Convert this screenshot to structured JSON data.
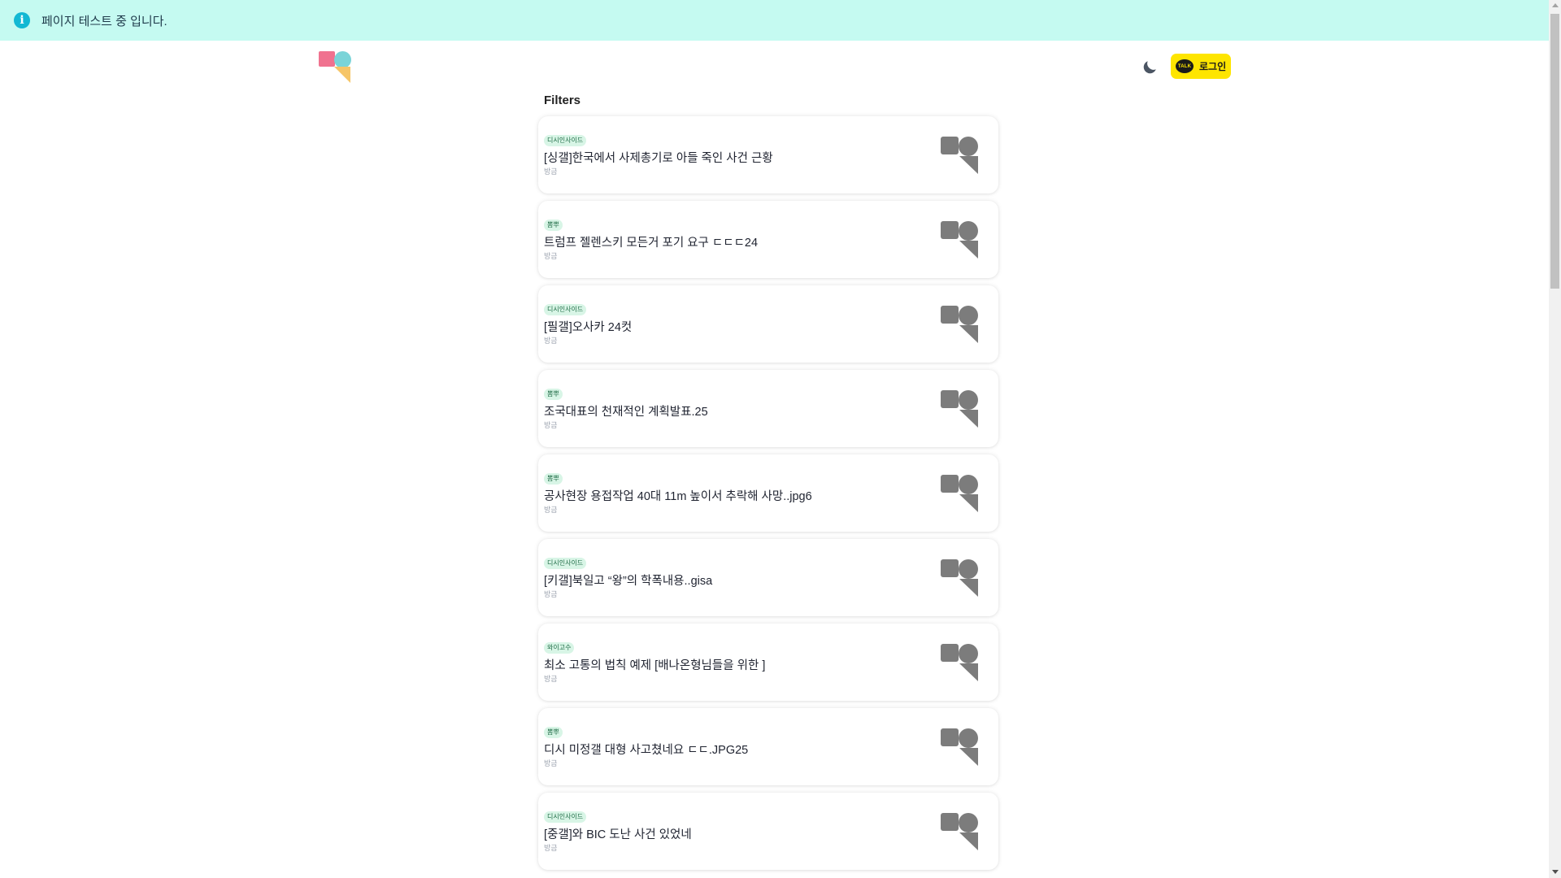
{
  "banner": {
    "icon": "info-icon",
    "icon_glyph": "i",
    "text": "페이지 테스트 중 입니다."
  },
  "header": {
    "logo": "app-logo",
    "theme_toggle_icon": "moon-icon",
    "login": {
      "badge": "TALK",
      "label": "로그인",
      "color": "#fee500"
    }
  },
  "filters": {
    "title": "Filters"
  },
  "feed": [
    {
      "source": "디시인사이드",
      "title": "[싱갤]한국에서 사제총기로 아들 죽인 사건 근황",
      "time": "방금"
    },
    {
      "source": "뽐뿌",
      "title": "트럼프 젤렌스키 모든거 포기 요구 ㄷㄷㄷ24",
      "time": "방금"
    },
    {
      "source": "디시인사이드",
      "title": "[필갤]오사카 24컷",
      "time": "방금"
    },
    {
      "source": "뽐뿌",
      "title": "조국대표의 천재적인 계획발표.25",
      "time": "방금"
    },
    {
      "source": "뽐뿌",
      "title": "공사현장 용접작업 40대 11m 높이서 추락해 사망..jpg6",
      "time": "방금"
    },
    {
      "source": "디시인사이드",
      "title": "[키갤]북일고 “왕”의 학폭내용..gisa",
      "time": "방금"
    },
    {
      "source": "와이고수",
      "title": "최소 고통의 법칙 예제  [배나온형님들을 위한 ]",
      "time": "방금"
    },
    {
      "source": "뽐뿌",
      "title": "디시 미정갤 대형 사고쳤네요 ㄷㄷ.JPG25",
      "time": "방금"
    },
    {
      "source": "디시인사이드",
      "title": "[중갤]와 BIC 도난 사건 있었네",
      "time": "방금"
    }
  ],
  "colors": {
    "banner_bg": "#c5faf1",
    "info_icon": "#13b8d3",
    "badge_bg": "#d8f5e6",
    "placeholder_gray": "#7c7c7c"
  }
}
